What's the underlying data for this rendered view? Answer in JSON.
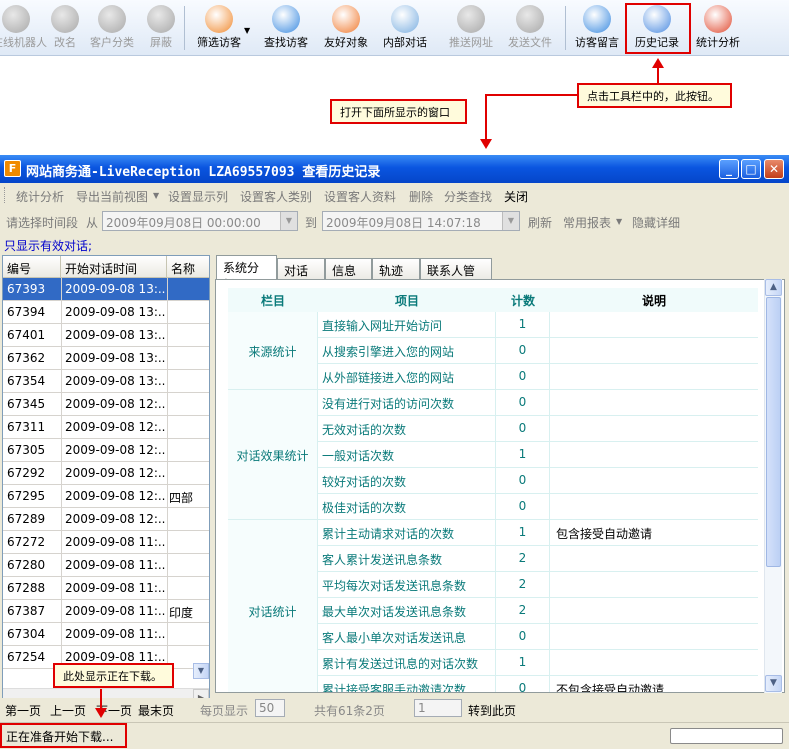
{
  "toolbar": {
    "items": [
      {
        "label": "在线机器人",
        "enabled": false,
        "icon": "robot-icon"
      },
      {
        "label": "改名",
        "enabled": false,
        "icon": "rename-icon"
      },
      {
        "label": "客户分类",
        "enabled": false,
        "icon": "customer-group-icon"
      },
      {
        "label": "屏蔽",
        "enabled": false,
        "icon": "block-icon"
      },
      {
        "label": "筛选访客",
        "enabled": true,
        "icon": "filter-visitor-icon"
      },
      {
        "label": "查找访客",
        "enabled": true,
        "icon": "find-visitor-icon"
      },
      {
        "label": "友好对象",
        "enabled": true,
        "icon": "friend-icon"
      },
      {
        "label": "内部对话",
        "enabled": true,
        "icon": "internal-chat-icon"
      },
      {
        "label": "推送网址",
        "enabled": false,
        "icon": "push-url-icon"
      },
      {
        "label": "发送文件",
        "enabled": false,
        "icon": "send-file-icon"
      },
      {
        "label": "访客留言",
        "enabled": true,
        "icon": "visitor-message-icon"
      },
      {
        "label": "历史记录",
        "enabled": true,
        "icon": "history-icon"
      },
      {
        "label": "统计分析",
        "enabled": true,
        "icon": "statistics-icon"
      }
    ]
  },
  "annotations": {
    "click_history": "点击工具栏中的，此按钮。",
    "open_window": "打开下面所显示的窗口",
    "downloading_here": "此处显示正在下载。"
  },
  "window": {
    "title": "网站商务通-LiveReception LZA69557093  查看历史记录",
    "menu": [
      "统计分析",
      "导出当前视图",
      "设置显示列",
      "设置客人类别",
      "设置客人资料",
      "删除",
      "分类查找",
      "关闭"
    ],
    "filter": {
      "period_label": "请选择时间段",
      "from_label": "从",
      "from_value": "2009年09月08日 00:00:00",
      "to_label": "到",
      "to_value": "2009年09月08日 14:07:18",
      "refresh": "刷新",
      "reports": "常用报表",
      "hide_details": "隐藏详细"
    },
    "valid_only": "只显示有效对话;",
    "list": {
      "headers": [
        "编号",
        "开始对话时间",
        "名称"
      ],
      "rows": [
        {
          "id": "67393",
          "time": "2009-09-08 13:...",
          "name": ""
        },
        {
          "id": "67394",
          "time": "2009-09-08 13:...",
          "name": ""
        },
        {
          "id": "67401",
          "time": "2009-09-08 13:...",
          "name": ""
        },
        {
          "id": "67362",
          "time": "2009-09-08 13:...",
          "name": ""
        },
        {
          "id": "67354",
          "time": "2009-09-08 13:...",
          "name": ""
        },
        {
          "id": "67345",
          "time": "2009-09-08 12:...",
          "name": ""
        },
        {
          "id": "67311",
          "time": "2009-09-08 12:...",
          "name": ""
        },
        {
          "id": "67305",
          "time": "2009-09-08 12:...",
          "name": ""
        },
        {
          "id": "67292",
          "time": "2009-09-08 12:...",
          "name": ""
        },
        {
          "id": "67295",
          "time": "2009-09-08 12:...",
          "name": "四部"
        },
        {
          "id": "67289",
          "time": "2009-09-08 12:...",
          "name": ""
        },
        {
          "id": "67272",
          "time": "2009-09-08 11:...",
          "name": ""
        },
        {
          "id": "67280",
          "time": "2009-09-08 11:...",
          "name": ""
        },
        {
          "id": "67288",
          "time": "2009-09-08 11:...",
          "name": ""
        },
        {
          "id": "67387",
          "time": "2009-09-08 11:...",
          "name": "印度"
        },
        {
          "id": "67304",
          "time": "2009-09-08 11:...",
          "name": ""
        },
        {
          "id": "67254",
          "time": "2009-09-08 11:...",
          "name": ""
        }
      ]
    },
    "tabs": [
      "系统分析",
      "对话",
      "信息",
      "轨迹",
      "联系人管理"
    ],
    "stats": {
      "headers": [
        "栏目",
        "项目",
        "计数",
        "说明"
      ],
      "groups": [
        {
          "category": "来源统计",
          "rows": [
            {
              "item": "直接输入网址开始访问",
              "count": "1",
              "desc": ""
            },
            {
              "item": "从搜索引擎进入您的网站",
              "count": "0",
              "desc": ""
            },
            {
              "item": "从外部链接进入您的网站",
              "count": "0",
              "desc": ""
            }
          ]
        },
        {
          "category": "对话效果统计",
          "rows": [
            {
              "item": "没有进行对话的访问次数",
              "count": "0",
              "desc": ""
            },
            {
              "item": "无效对话的次数",
              "count": "0",
              "desc": ""
            },
            {
              "item": "一般对话次数",
              "count": "1",
              "desc": ""
            },
            {
              "item": "较好对话的次数",
              "count": "0",
              "desc": ""
            },
            {
              "item": "极佳对话的次数",
              "count": "0",
              "desc": ""
            }
          ]
        },
        {
          "category": "对话统计",
          "rows": [
            {
              "item": "累计主动请求对话的次数",
              "count": "1",
              "desc": "包含接受自动邀请"
            },
            {
              "item": "客人累计发送讯息条数",
              "count": "2",
              "desc": ""
            },
            {
              "item": "平均每次对话发送讯息条数",
              "count": "2",
              "desc": ""
            },
            {
              "item": "最大单次对话发送讯息条数",
              "count": "2",
              "desc": ""
            },
            {
              "item": "客人最小单次对话发送讯息",
              "count": "0",
              "desc": ""
            },
            {
              "item": "累计有发送过讯息的对话次数",
              "count": "1",
              "desc": ""
            },
            {
              "item": "累计接受客服手动邀请次数",
              "count": "0",
              "desc": "不包含接受自动邀请"
            }
          ]
        }
      ]
    },
    "pager": {
      "first": "第一页",
      "prev": "上一页",
      "next": "下一页",
      "last": "最末页",
      "per_page_label": "每页显示",
      "per_page_value": "50",
      "total": "共有61条2页",
      "page_value": "1",
      "goto": "转到此页"
    },
    "status": "正在准备开始下载..."
  },
  "colors": {
    "highlight": "#e00000",
    "accent": "#0a7a7a",
    "selection": "#316ac5"
  }
}
